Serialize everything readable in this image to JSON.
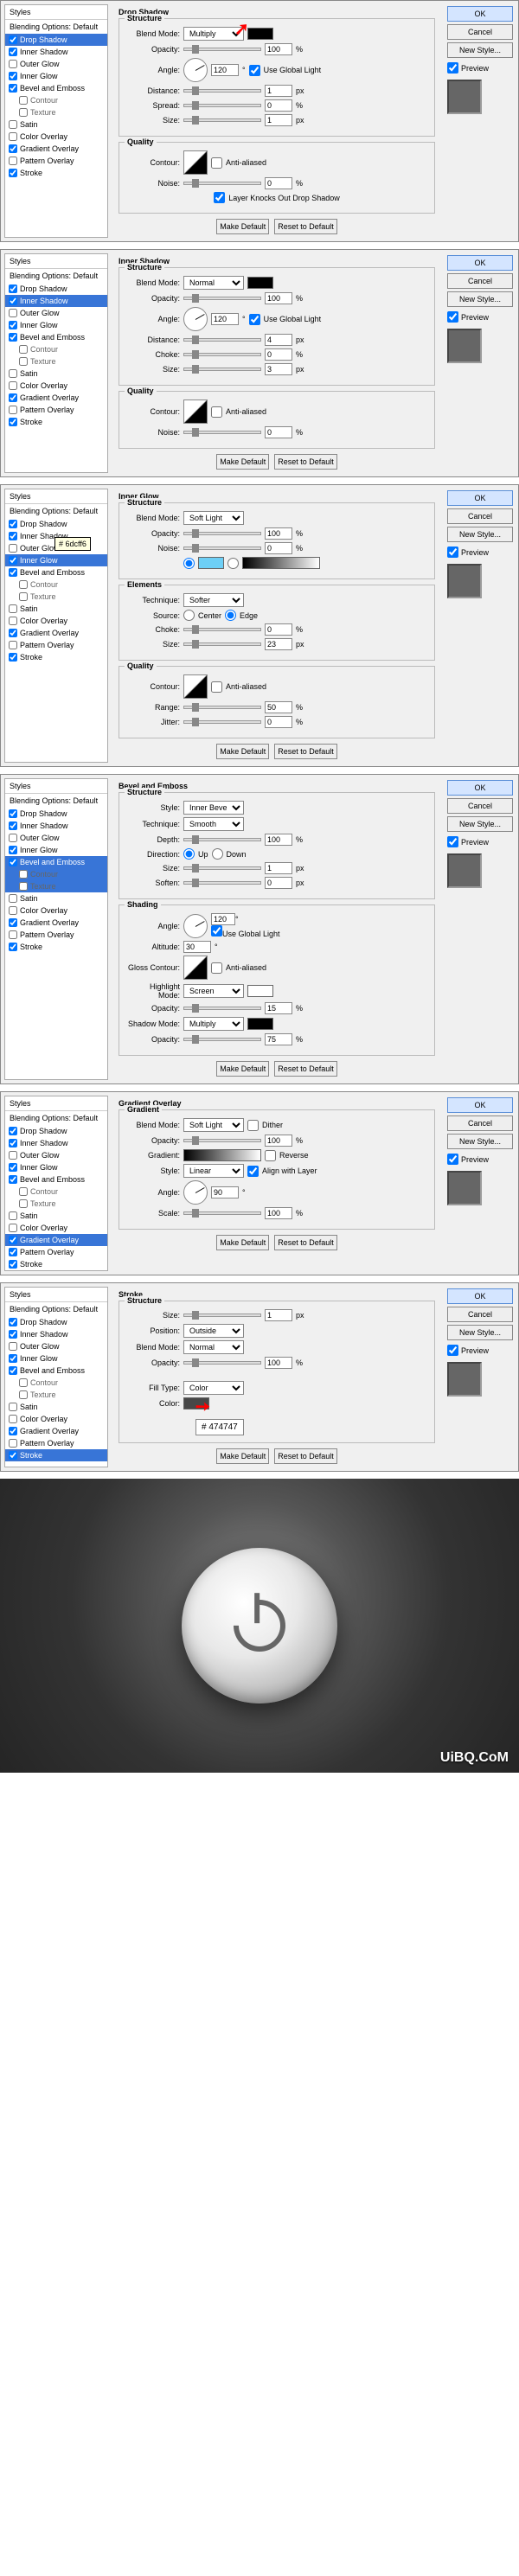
{
  "common": {
    "styles_header": "Styles",
    "blending_options": "Blending Options: Default",
    "ok": "OK",
    "cancel": "Cancel",
    "new_style": "New Style...",
    "preview": "Preview",
    "make_default": "Make Default",
    "reset_default": "Reset to Default",
    "structure": "Structure",
    "quality": "Quality",
    "blend_mode": "Blend Mode:",
    "opacity": "Opacity:",
    "angle": "Angle:",
    "use_global": "Use Global Light",
    "distance": "Distance:",
    "spread": "Spread:",
    "choke": "Choke:",
    "size": "Size:",
    "contour": "Contour:",
    "noise": "Noise:",
    "anti_aliased": "Anti-aliased",
    "px": "px",
    "pct": "%",
    "deg": "°",
    "style_items": [
      "Drop Shadow",
      "Inner Shadow",
      "Outer Glow",
      "Inner Glow",
      "Bevel and Emboss",
      "Contour",
      "Texture",
      "Satin",
      "Color Overlay",
      "Gradient Overlay",
      "Pattern Overlay",
      "Stroke"
    ]
  },
  "d1": {
    "title": "Drop Shadow",
    "active": "Drop Shadow",
    "checked": [
      "Drop Shadow",
      "Inner Shadow",
      "Inner Glow",
      "Bevel and Emboss",
      "Gradient Overlay",
      "Stroke"
    ],
    "blend_mode": "Multiply",
    "opacity": "100",
    "angle": "120",
    "distance": "1",
    "spread": "0",
    "size": "1",
    "noise": "0",
    "knockout": "Layer Knocks Out Drop Shadow",
    "color": "#000000"
  },
  "d2": {
    "title": "Inner Shadow",
    "active": "Inner Shadow",
    "checked": [
      "Drop Shadow",
      "Inner Shadow",
      "Inner Glow",
      "Bevel and Emboss",
      "Gradient Overlay",
      "Stroke"
    ],
    "blend_mode": "Normal",
    "opacity": "100",
    "angle": "120",
    "distance": "4",
    "choke": "0",
    "size": "3",
    "noise": "0",
    "color": "#000000"
  },
  "d3": {
    "title": "Inner Glow",
    "active": "Inner Glow",
    "checked": [
      "Drop Shadow",
      "Inner Shadow",
      "Inner Glow",
      "Bevel and Emboss",
      "Gradient Overlay",
      "Stroke"
    ],
    "blend_mode": "Soft Light",
    "opacity": "100",
    "noise": "0",
    "elements": "Elements",
    "technique_l": "Technique:",
    "technique": "Softer",
    "source_l": "Source:",
    "center": "Center",
    "edge": "Edge",
    "choke": "0",
    "size": "23",
    "range_l": "Range:",
    "range": "50",
    "jitter_l": "Jitter:",
    "jitter": "0",
    "tooltip": "# 6dcff6"
  },
  "d4": {
    "title": "Bevel and Emboss",
    "active": "Bevel and Emboss",
    "checked": [
      "Drop Shadow",
      "Inner Shadow",
      "Inner Glow",
      "Bevel and Emboss",
      "Gradient Overlay",
      "Stroke"
    ],
    "style_l": "Style:",
    "style": "Inner Bevel",
    "technique_l": "Technique:",
    "technique": "Smooth",
    "depth_l": "Depth:",
    "depth": "100",
    "direction_l": "Direction:",
    "up": "Up",
    "down": "Down",
    "size": "1",
    "soften_l": "Soften:",
    "soften": "0",
    "shading": "Shading",
    "angle": "120",
    "altitude_l": "Altitude:",
    "altitude": "30",
    "gloss_l": "Gloss Contour:",
    "highlight_l": "Highlight Mode:",
    "highlight": "Screen",
    "h_opacity": "15",
    "shadow_l": "Shadow Mode:",
    "shadow": "Multiply",
    "s_opacity": "75"
  },
  "d5": {
    "title": "Gradient Overlay",
    "sub": "Gradient",
    "active": "Gradient Overlay",
    "checked": [
      "Drop Shadow",
      "Inner Shadow",
      "Inner Glow",
      "Bevel and Emboss",
      "Gradient Overlay",
      "Pattern Overlay",
      "Stroke"
    ],
    "blend_mode": "Soft Light",
    "opacity": "100",
    "dither": "Dither",
    "gradient_l": "Gradient:",
    "reverse": "Reverse",
    "style_l": "Style:",
    "style": "Linear",
    "align": "Align with Layer",
    "angle": "90",
    "scale_l": "Scale:",
    "scale": "100"
  },
  "d6": {
    "title": "Stroke",
    "active": "Stroke",
    "checked": [
      "Drop Shadow",
      "Inner Shadow",
      "Inner Glow",
      "Bevel and Emboss",
      "Gradient Overlay",
      "Stroke"
    ],
    "size": "1",
    "position_l": "Position:",
    "position": "Outside",
    "blend_mode": "Normal",
    "opacity": "100",
    "fill_l": "Fill Type:",
    "fill": "Color",
    "color_l": "Color:",
    "hex": "# 474747"
  },
  "footer": {
    "logo": "UiBQ.CoM"
  }
}
